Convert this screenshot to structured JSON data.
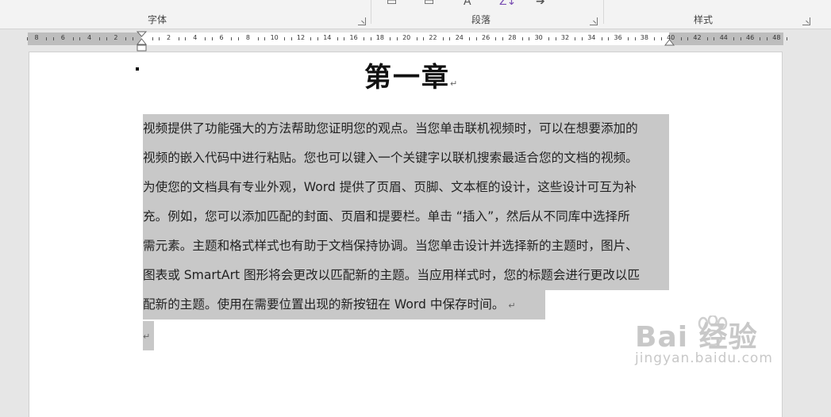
{
  "ribbon": {
    "groups": {
      "font": "字体",
      "paragraph": "段落",
      "styles": "样式"
    }
  },
  "ruler": {
    "labels": [
      "8",
      "6",
      "4",
      "2",
      "",
      "2",
      "4",
      "6",
      "8",
      "10",
      "12",
      "14",
      "16",
      "18",
      "20",
      "22",
      "24",
      "26",
      "28",
      "30",
      "32",
      "34",
      "36",
      "38",
      "40",
      "42",
      "44",
      "46",
      "48"
    ]
  },
  "document": {
    "heading": "第一章",
    "return_symbol": "↵",
    "paragraph_lines": [
      "视频提供了功能强大的方法帮助您证明您的观点。当您单击联机视频时，可以在想要添加的",
      "视频的嵌入代码中进行粘贴。您也可以键入一个关键字以联机搜索最适合您的文档的视频。",
      "为使您的文档具有专业外观，Word 提供了页眉、页脚、文本框的设计，这些设计可互为补",
      "充。例如，您可以添加匹配的封面、页眉和提要栏。单击 “插入”，然后从不同库中选择所",
      "需元素。主题和格式样式也有助于文档保持协调。当您单击设计并选择新的主题时，图片、",
      "图表或 SmartArt 图形将会更改以匹配新的主题。当应用样式时，您的标题会进行更改以匹",
      "配新的主题。使用在需要位置出现的新按钮在 Word 中保存时间。"
    ]
  },
  "watermark": {
    "brand": "Bai  经验",
    "url": "jingyan.baidu.com"
  },
  "colors": {
    "selection": "#c8c8c8",
    "page": "#ffffff",
    "background": "#e6e6e6"
  }
}
